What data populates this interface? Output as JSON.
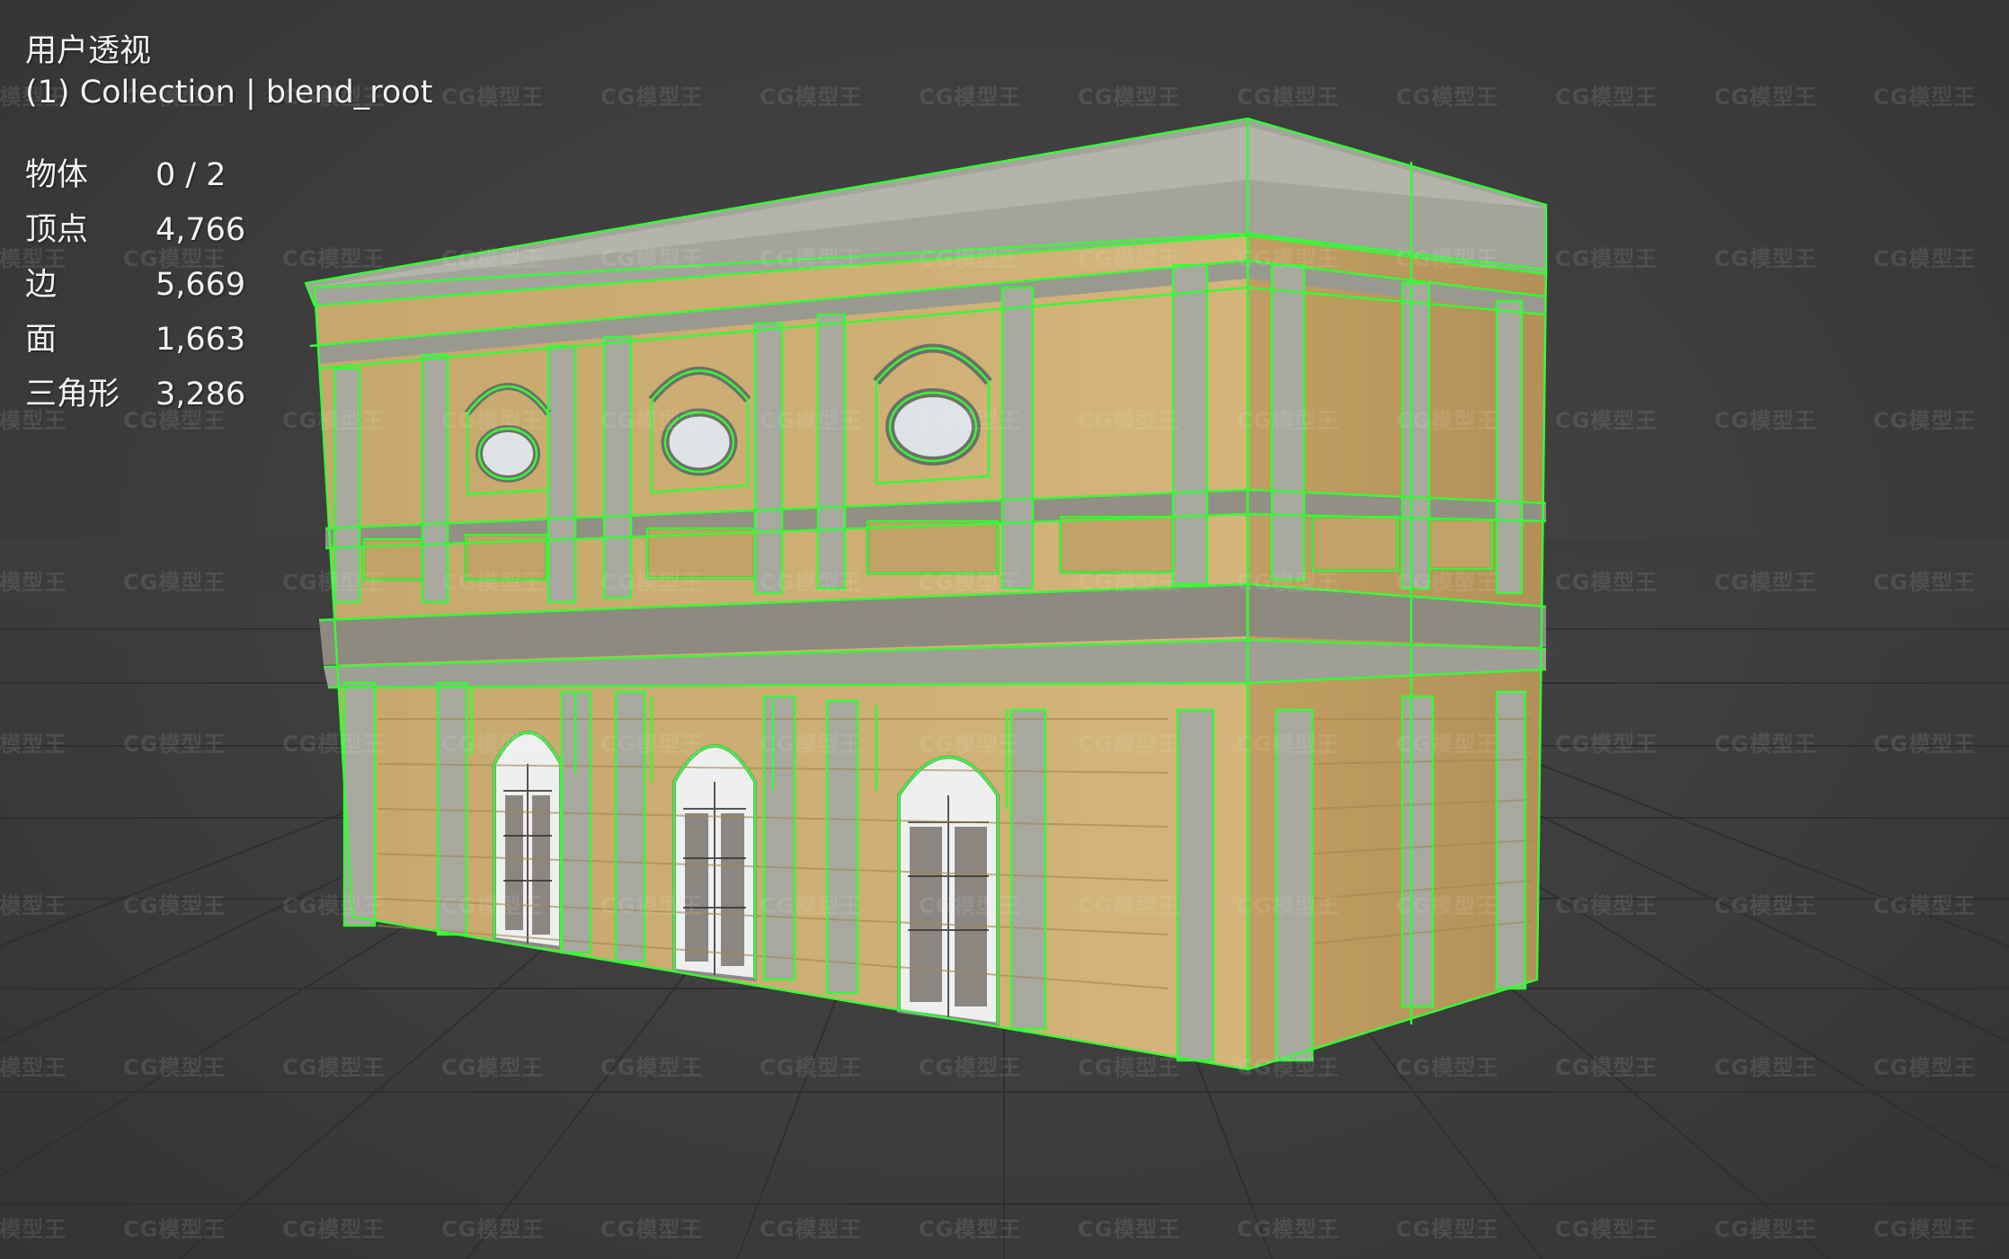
{
  "viewport": {
    "view_name": "用户透视",
    "collection_label": "(1) Collection | blend_root"
  },
  "stats": [
    {
      "label": "物体",
      "value": "0 / 2"
    },
    {
      "label": "顶点",
      "value": "4,766"
    },
    {
      "label": "边",
      "value": "5,669"
    },
    {
      "label": "面",
      "value": "1,663"
    },
    {
      "label": "三角形",
      "value": "3,286"
    }
  ],
  "watermark_text": "CG模型王",
  "colors": {
    "background": "#3d3d3d",
    "grid": "#2e2e2e",
    "wireframe": "#33ff33",
    "wall": "#c9a96a",
    "stone": "#9b9c95"
  }
}
